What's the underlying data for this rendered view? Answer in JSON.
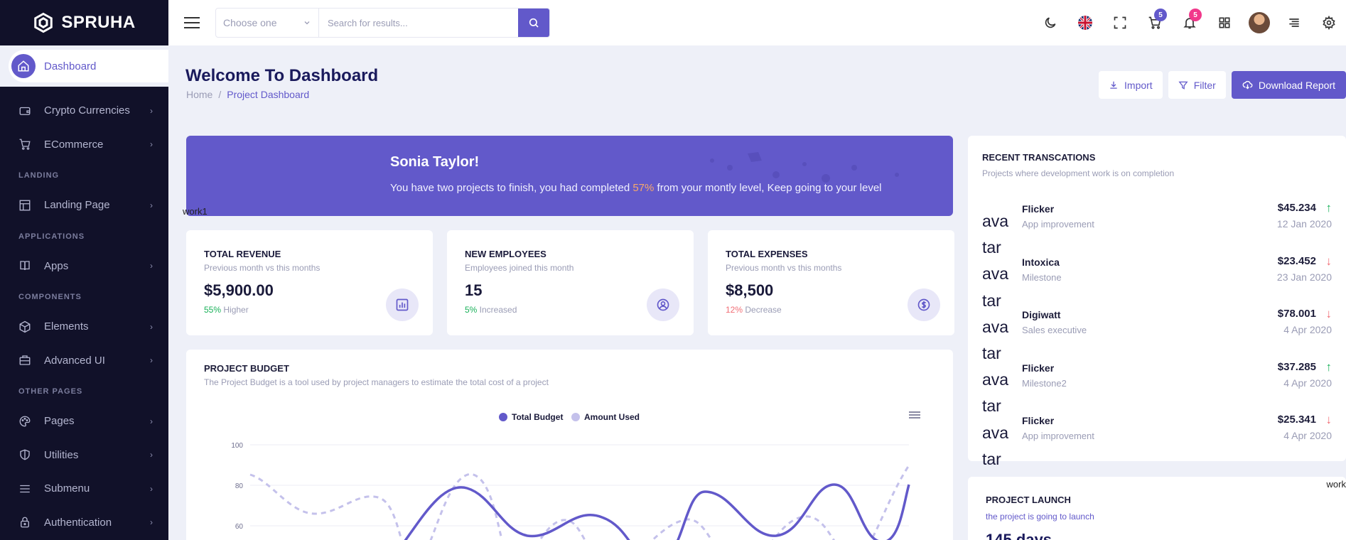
{
  "brand": {
    "name": "SPRUHA"
  },
  "sidebar": {
    "active": {
      "label": "Dashboard"
    },
    "items": [
      {
        "label": "Crypto Currencies",
        "icon": "wallet-icon",
        "type": "item"
      },
      {
        "label": "ECommerce",
        "icon": "cart-icon",
        "type": "item"
      },
      {
        "label": "LANDING",
        "type": "category"
      },
      {
        "label": "Landing Page",
        "icon": "layout-icon",
        "type": "item"
      },
      {
        "label": "APPLICATIONS",
        "type": "category"
      },
      {
        "label": "Apps",
        "icon": "book-icon",
        "type": "item"
      },
      {
        "label": "COMPONENTS",
        "type": "category"
      },
      {
        "label": "Elements",
        "icon": "box-icon",
        "type": "item"
      },
      {
        "label": "Advanced UI",
        "icon": "briefcase-icon",
        "type": "item"
      },
      {
        "label": "OTHER PAGES",
        "type": "category"
      },
      {
        "label": "Pages",
        "icon": "palette-icon",
        "type": "item"
      },
      {
        "label": "Utilities",
        "icon": "shield-icon",
        "type": "item"
      },
      {
        "label": "Submenu",
        "icon": "menu-icon",
        "type": "item"
      },
      {
        "label": "Authentication",
        "icon": "lock-icon",
        "type": "item"
      }
    ]
  },
  "header": {
    "select_placeholder": "Choose one",
    "search_placeholder": "Search for results...",
    "cart_count": "5",
    "notif_count": "5",
    "colors": {
      "accent": "#6259ca",
      "badge_pink": "#f1388b"
    }
  },
  "page": {
    "title": "Welcome To Dashboard",
    "breadcrumb": [
      "Home",
      "Project Dashboard"
    ],
    "actions": {
      "import": "Import",
      "filter": "Filter",
      "download": "Download Report"
    }
  },
  "banner": {
    "name": "Sonia Taylor!",
    "msg_before": "You have two projects to finish, you had completed ",
    "msg_pct": "57%",
    "msg_after": " from your montly level, Keep going to your level",
    "img_alt": "work1"
  },
  "stats": [
    {
      "title": "TOTAL REVENUE",
      "sub": "Previous month vs this months",
      "value": "$5,900.00",
      "pct": "55%",
      "trend": " Higher",
      "pct_color": "#19b159"
    },
    {
      "title": "NEW EMPLOYEES",
      "sub": "Employees joined this month",
      "value": "15",
      "pct": "5%",
      "trend": " Increased",
      "pct_color": "#19b159"
    },
    {
      "title": "TOTAL EXPENSES",
      "sub": "Previous month vs this months",
      "value": "$8,500",
      "pct": "12%",
      "trend": " Decrease",
      "pct_color": "#f16d75"
    }
  ],
  "budget": {
    "title": "PROJECT BUDGET",
    "sub": "The Project Budget is a tool used by project managers to estimate the total cost of a project"
  },
  "chart_data": {
    "type": "line",
    "series": [
      {
        "name": "Total Budget",
        "color": "#6259ca",
        "style": "solid"
      },
      {
        "name": "Amount Used",
        "color": "#c4c1eb",
        "style": "dashed"
      }
    ],
    "y_ticks": [
      "100",
      "80",
      "60"
    ],
    "ylim": [
      40,
      100
    ]
  },
  "transactions": {
    "title": "RECENT TRANSCATIONS",
    "sub": "Projects where development work is on completion",
    "alt_lines": [
      "ava",
      "tar",
      "ava",
      "tar",
      "ava",
      "tar",
      "ava",
      "tar",
      "ava",
      "tar"
    ],
    "rows": [
      {
        "name": "Flicker",
        "sub": "App improvement",
        "amount": "$45.234",
        "dir": "up",
        "date": "12 Jan 2020"
      },
      {
        "name": "Intoxica",
        "sub": "Milestone",
        "amount": "$23.452",
        "dir": "down",
        "date": "23 Jan 2020"
      },
      {
        "name": "Digiwatt",
        "sub": "Sales executive",
        "amount": "$78.001",
        "dir": "down",
        "date": "4 Apr 2020"
      },
      {
        "name": "Flicker",
        "sub": "Milestone2",
        "amount": "$37.285",
        "dir": "up",
        "date": "4 Apr 2020"
      },
      {
        "name": "Flicker",
        "sub": "App improvement",
        "amount": "$25.341",
        "dir": "down",
        "date": "4 Apr 2020"
      }
    ]
  },
  "launch": {
    "title": "PROJECT LAUNCH",
    "sub": "the project is going to launch",
    "days": "145 days",
    "img_alt": "work"
  }
}
